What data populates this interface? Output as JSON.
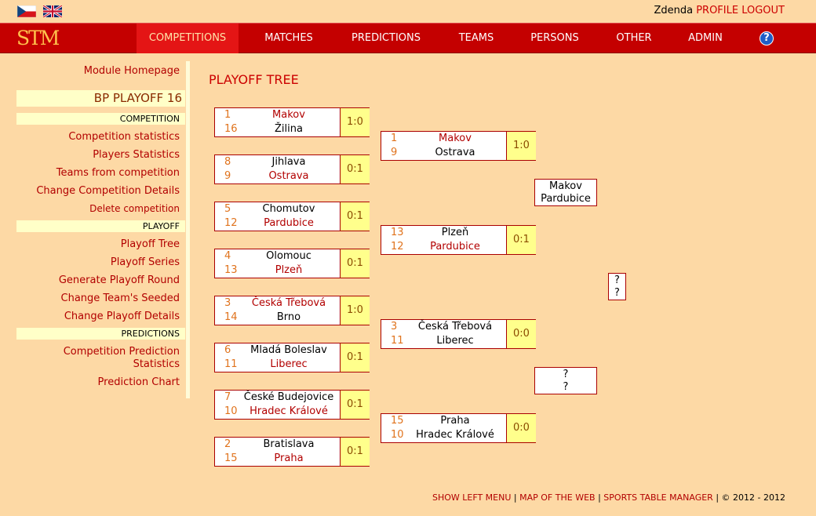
{
  "user": {
    "name": "Zdenda",
    "profile": "PROFILE",
    "logout": "LOGOUT"
  },
  "nav": {
    "logo": "STM",
    "items": [
      "COMPETITIONS",
      "MATCHES",
      "PREDICTIONS",
      "TEAMS",
      "PERSONS",
      "OTHER",
      "ADMIN"
    ],
    "active": "COMPETITIONS",
    "help": "?"
  },
  "sidebar": {
    "module_home": "Module Homepage",
    "competition_name": "BP PLAYOFF 16",
    "competition_header": "COMPETITION",
    "competition_links": [
      "Competition statistics",
      "Players Statistics",
      "Teams from competition",
      "Change Competition Details",
      "Delete competition"
    ],
    "playoff_header": "PLAYOFF",
    "playoff_links": [
      "Playoff Tree",
      "Playoff Series",
      "Generate Playoff Round",
      "Change Team's Seeded",
      "Change Playoff Details"
    ],
    "predictions_header": "PREDICTIONS",
    "prediction_links": [
      "Competition Prediction",
      "Statistics",
      "Prediction Chart"
    ]
  },
  "page_title": "PLAYOFF TREE",
  "round1": [
    {
      "seed1": "1",
      "team1": "Makov",
      "seed2": "16",
      "team2": "Žilina",
      "score": "1:0",
      "winner": 1
    },
    {
      "seed1": "8",
      "team1": "Jihlava",
      "seed2": "9",
      "team2": "Ostrava",
      "score": "0:1",
      "winner": 2
    },
    {
      "seed1": "5",
      "team1": "Chomutov",
      "seed2": "12",
      "team2": "Pardubice",
      "score": "0:1",
      "winner": 2
    },
    {
      "seed1": "4",
      "team1": "Olomouc",
      "seed2": "13",
      "team2": "Plzeň",
      "score": "0:1",
      "winner": 2
    },
    {
      "seed1": "3",
      "team1": "Česká Třebová",
      "seed2": "14",
      "team2": "Brno",
      "score": "1:0",
      "winner": 1
    },
    {
      "seed1": "6",
      "team1": "Mladá Boleslav",
      "seed2": "11",
      "team2": "Liberec",
      "score": "0:1",
      "winner": 2
    },
    {
      "seed1": "7",
      "team1": "České Budejovice",
      "seed2": "10",
      "team2": "Hradec Králové",
      "score": "0:1",
      "winner": 2
    },
    {
      "seed1": "2",
      "team1": "Bratislava",
      "seed2": "15",
      "team2": "Praha",
      "score": "0:1",
      "winner": 2
    }
  ],
  "round2": [
    {
      "seed1": "1",
      "team1": "Makov",
      "seed2": "9",
      "team2": "Ostrava",
      "score": "1:0",
      "winner": 1
    },
    {
      "seed1": "13",
      "team1": "Plzeň",
      "seed2": "12",
      "team2": "Pardubice",
      "score": "0:1",
      "winner": 2
    },
    {
      "seed1": "3",
      "team1": "Česká Třebová",
      "seed2": "11",
      "team2": "Liberec",
      "score": "0:0",
      "winner": 0
    },
    {
      "seed1": "15",
      "team1": "Praha",
      "seed2": "10",
      "team2": "Hradec Králové",
      "score": "0:0",
      "winner": 0
    }
  ],
  "semifinals": [
    {
      "team1": "Makov",
      "team2": "Pardubice"
    },
    {
      "team1": "?",
      "team2": "?"
    }
  ],
  "final": {
    "team1": "?",
    "team2": "?"
  },
  "footer": {
    "show_left_menu": "SHOW LEFT MENU",
    "map": "MAP OF THE WEB",
    "stm": "SPORTS TABLE MANAGER",
    "separator": "|",
    "copyright": "© 2012 - 2012"
  }
}
